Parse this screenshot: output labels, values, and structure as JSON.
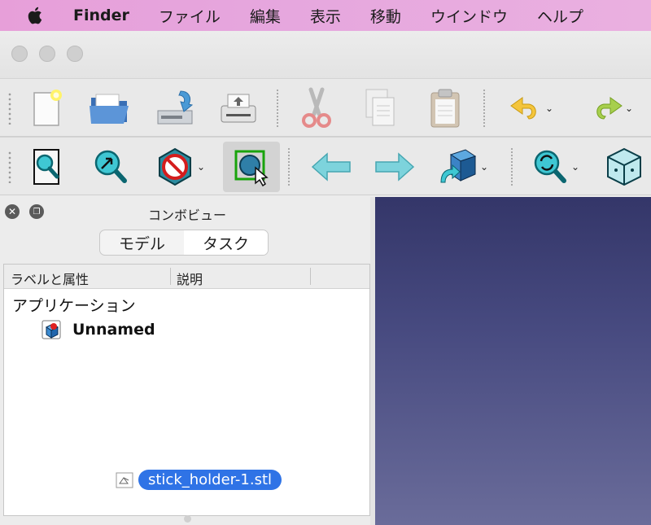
{
  "menubar": {
    "app": "Finder",
    "items": [
      "ファイル",
      "編集",
      "表示",
      "移動",
      "ウインドウ",
      "ヘルプ"
    ]
  },
  "toolbar1": {
    "icons": [
      "new-document",
      "open-folder",
      "save",
      "print",
      "cut",
      "copy",
      "paste",
      "undo",
      "redo"
    ]
  },
  "toolbar2": {
    "icons": [
      "fit-all",
      "fit-selection",
      "draw-style",
      "bounding-box",
      "nav-back",
      "nav-forward",
      "std-views",
      "sync-view",
      "axonometric"
    ]
  },
  "combo": {
    "title": "コンボビュー",
    "tabs": [
      "モデル",
      "タスク"
    ],
    "columns": [
      "ラベルと属性",
      "説明"
    ],
    "root_label": "アプリケーション",
    "document_label": "Unnamed"
  },
  "drag": {
    "filename": "stick_holder-1.stl"
  },
  "colors": {
    "menubar": "#e79fd9",
    "selection": "#2f73e6",
    "viewport_top": "#343669",
    "viewport_bottom": "#6a6c9a"
  }
}
